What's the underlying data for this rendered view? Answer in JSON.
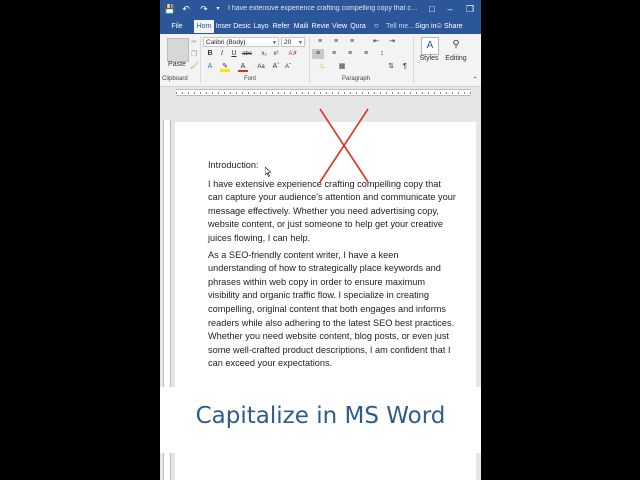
{
  "window": {
    "title": "I have extensive experience crafting compelling copy that ca...",
    "accent": "#2b579a"
  },
  "quick_access": {
    "save_icon": "save-icon",
    "undo_icon": "undo-icon",
    "redo_icon": "redo-icon"
  },
  "tabs": [
    {
      "label": "File"
    },
    {
      "label": "Hom"
    },
    {
      "label": "Inser"
    },
    {
      "label": "Desic"
    },
    {
      "label": "Layo"
    },
    {
      "label": "Refer"
    },
    {
      "label": "Maili"
    },
    {
      "label": "Revie"
    },
    {
      "label": "View"
    },
    {
      "label": "Qura"
    }
  ],
  "tell_me": "Tell me...",
  "sign_in": "Sign in",
  "share": "Share",
  "ribbon": {
    "paste_label": "Paste",
    "font_name": "Calibri (Body)",
    "font_size": "20",
    "bold": "B",
    "italic": "I",
    "underline": "U",
    "styles_label": "Styles",
    "editing_label": "Editing",
    "clipboard_label": "Clipboard",
    "font_label": "Font",
    "paragraph_label": "Paragraph"
  },
  "document": {
    "heading": "Introduction:",
    "paragraphs": [
      "I have extensive experience crafting compelling copy that can capture your audience's attention and communicate your message effectively. Whether you need advertising copy, website content, or just someone to help get your creative juices flowing, I can help.",
      "As a SEO-friendly content writer, I have a keen understanding of how to strategically place keywords and phrases within web copy in order to ensure maximum visibility and organic traffic flow. I specialize in creating compelling, original content that both engages and informs readers while also adhering to the latest SEO best practices. Whether you need website content, blog posts, or even just some well-crafted product descriptions, I am confident that I can exceed your expectations."
    ]
  },
  "banner": {
    "text": "Capitalize in MS Word",
    "color": "#2e5c8a"
  },
  "annotation": {
    "color": "#e0301e"
  }
}
